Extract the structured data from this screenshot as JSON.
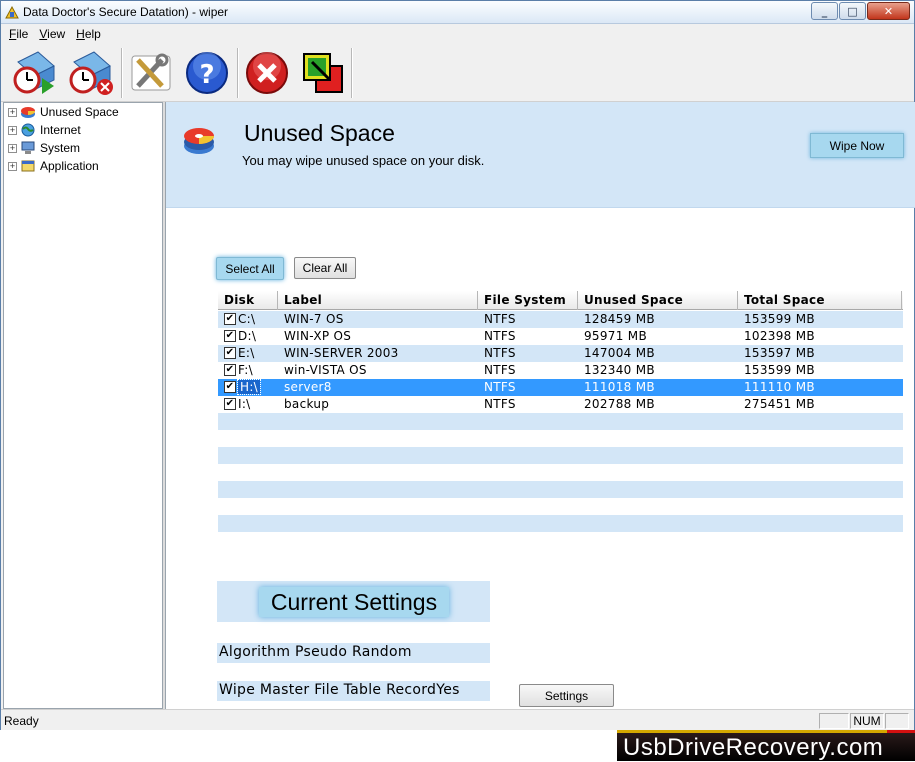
{
  "window": {
    "title": "Data Doctor's Secure Datation) - wiper",
    "controls": [
      "_",
      "□",
      "✕"
    ]
  },
  "menu": [
    {
      "label": "File",
      "accel": "F",
      "rest": "ile"
    },
    {
      "label": "View",
      "accel": "V",
      "rest": "iew"
    },
    {
      "label": "Help",
      "accel": "H",
      "rest": "elp"
    }
  ],
  "toolbar": {
    "icons": [
      "schedule-start-icon",
      "schedule-stop-icon",
      "settings-tools-icon",
      "help-icon",
      "exit-icon",
      "resize-window-icon"
    ]
  },
  "tree": {
    "items": [
      {
        "label": "Unused Space",
        "icon": "disk-icon"
      },
      {
        "label": "Internet",
        "icon": "globe-icon"
      },
      {
        "label": "System",
        "icon": "computer-icon"
      },
      {
        "label": "Application",
        "icon": "application-icon"
      }
    ]
  },
  "header": {
    "title": "Unused Space",
    "subtitle": "You may wipe unused space on your disk.",
    "wipe_now": "Wipe Now"
  },
  "list_buttons": {
    "select_all": "Select All",
    "clear_all": "Clear All"
  },
  "disk_table": {
    "columns": [
      "Disk",
      "Label",
      "File System",
      "Unused Space",
      "Total Space"
    ],
    "rows": [
      {
        "disk": "C:\\",
        "label": "WIN-7 OS",
        "fs": "NTFS",
        "unused": "128459 MB",
        "total": "153599 MB",
        "checked": true
      },
      {
        "disk": "D:\\",
        "label": "WIN-XP OS",
        "fs": "NTFS",
        "unused": "95971 MB",
        "total": "102398 MB",
        "checked": true
      },
      {
        "disk": "E:\\",
        "label": "WIN-SERVER 2003",
        "fs": "NTFS",
        "unused": "147004 MB",
        "total": "153597 MB",
        "checked": true
      },
      {
        "disk": "F:\\",
        "label": "win-VISTA OS",
        "fs": "NTFS",
        "unused": "132340 MB",
        "total": "153599 MB",
        "checked": true
      },
      {
        "disk": "H:\\",
        "label": "server8",
        "fs": "NTFS",
        "unused": "111018 MB",
        "total": "111110 MB",
        "checked": true
      },
      {
        "disk": "I:\\",
        "label": "backup",
        "fs": "NTFS",
        "unused": "202788 MB",
        "total": "275451 MB",
        "checked": true
      }
    ],
    "selected_row": 4
  },
  "settings": {
    "title": "Current Settings",
    "algorithm": "Algorithm Pseudo Random",
    "wipe_mft": "Wipe Master File Table RecordYes",
    "button": "Settings"
  },
  "status": {
    "text": "Ready",
    "num": "NUM"
  },
  "watermark": {
    "text": "UsbDriveRecovery.com"
  },
  "colors": {
    "accent_light": "#d3e6f7",
    "button_hot": "#a7d8ef",
    "selection": "#3399ff"
  }
}
